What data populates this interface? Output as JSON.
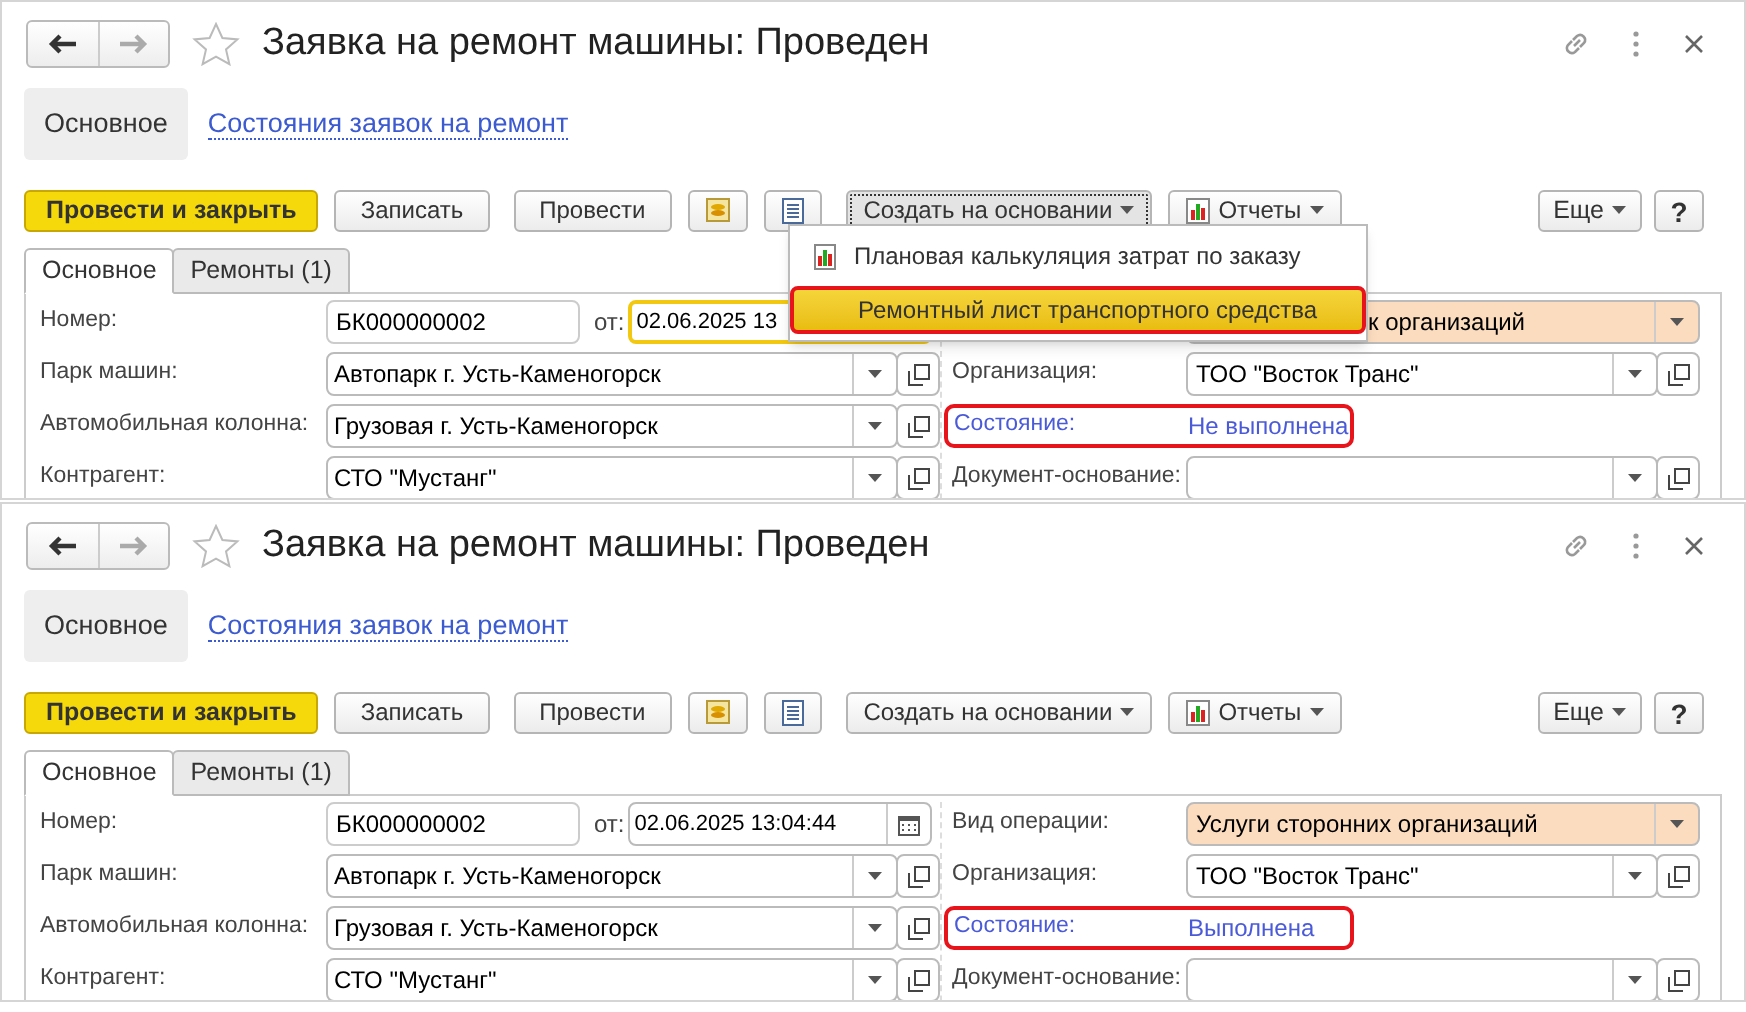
{
  "screens": [
    {
      "title": "Заявка на ремонт машины: Проведен",
      "nav": [
        {
          "label": "Основное",
          "selected": true
        },
        {
          "label": "Состояния заявок на ремонт",
          "selected": false
        }
      ],
      "toolbar": [
        {
          "kind": "primary",
          "label": "Провести и закрыть"
        },
        {
          "kind": "button",
          "label": "Записать"
        },
        {
          "kind": "button",
          "label": "Провести"
        },
        {
          "kind": "coins"
        },
        {
          "kind": "sheet"
        },
        {
          "kind": "menu",
          "label": "Создать на основании",
          "expanded": true
        },
        {
          "kind": "report-menu",
          "label": "Отчеты",
          "expanded": false
        }
      ],
      "toolbar_right": [
        {
          "kind": "menu",
          "label": "Еще"
        },
        {
          "kind": "help",
          "label": "?"
        }
      ],
      "tabs": [
        {
          "label": "Основное",
          "selected": true
        },
        {
          "label": "Ремонты (1)",
          "selected": false
        }
      ],
      "left": [
        {
          "kind": "number",
          "label": "Номер:",
          "value": "БК000000002",
          "date_label": "от:",
          "date_value": "02.06.2025 13",
          "date_focused": true
        },
        {
          "kind": "select",
          "label": "Парк машин:",
          "value": "Автопарк г. Усть-Каменогорск"
        },
        {
          "kind": "select",
          "label": "Автомобильная колонна:",
          "value": "Грузовая г. Усть-Каменогорск"
        },
        {
          "kind": "select",
          "label": "Контрагент:",
          "value": "СТО \"Мустанг\""
        }
      ],
      "right": [
        {
          "kind": "choice",
          "value": "к организаций",
          "tinted": true,
          "covered": true
        },
        {
          "kind": "select",
          "label": "Организация:",
          "value": "ТОО \"Восток Транс\""
        },
        {
          "kind": "status",
          "label": "Состояние:",
          "value": "Не выполнена",
          "outlined": true
        },
        {
          "kind": "select",
          "label": "Документ-основание:"
        }
      ],
      "menu": [
        {
          "label": "Плановая калькуляция затрат по заказу",
          "highlighted": false,
          "icon": true
        },
        {
          "label": "Ремонтный лист транспортного средства",
          "highlighted": true,
          "icon": false
        }
      ]
    },
    {
      "title": "Заявка на ремонт машины: Проведен",
      "nav": [
        {
          "label": "Основное",
          "selected": true
        },
        {
          "label": "Состояния заявок на ремонт",
          "selected": false
        }
      ],
      "toolbar": [
        {
          "kind": "primary",
          "label": "Провести и закрыть"
        },
        {
          "kind": "button",
          "label": "Записать"
        },
        {
          "kind": "button",
          "label": "Провести"
        },
        {
          "kind": "coins"
        },
        {
          "kind": "sheet"
        },
        {
          "kind": "menu",
          "label": "Создать на основании",
          "expanded": false
        },
        {
          "kind": "report-menu",
          "label": "Отчеты",
          "expanded": false
        }
      ],
      "toolbar_right": [
        {
          "kind": "menu",
          "label": "Еще"
        },
        {
          "kind": "help",
          "label": "?"
        }
      ],
      "tabs": [
        {
          "label": "Основное",
          "selected": true
        },
        {
          "label": "Ремонты (1)",
          "selected": false
        }
      ],
      "left": [
        {
          "kind": "number",
          "label": "Номер:",
          "value": "БК000000002",
          "date_label": "от:",
          "date_value": "02.06.2025 13:04:44",
          "date_focused": false
        },
        {
          "kind": "select",
          "label": "Парк машин:",
          "value": "Автопарк г. Усть-Каменогорск"
        },
        {
          "kind": "select",
          "label": "Автомобильная колонна:",
          "value": "Грузовая г. Усть-Каменогорск"
        },
        {
          "kind": "select",
          "label": "Контрагент:",
          "value": "СТО \"Мустанг\""
        }
      ],
      "right": [
        {
          "kind": "choice",
          "label": "Вид операции:",
          "value": "Услуги сторонних организаций",
          "tinted": true,
          "covered": false
        },
        {
          "kind": "select",
          "label": "Организация:",
          "value": "ТОО \"Восток Транс\""
        },
        {
          "kind": "status",
          "label": "Состояние:",
          "value": "Выполнена",
          "outlined": true
        },
        {
          "kind": "select",
          "label": "Документ-основание:"
        }
      ]
    }
  ]
}
